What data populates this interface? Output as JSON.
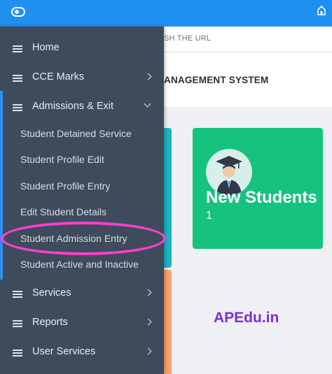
{
  "urlbar": {
    "text": "SH THE URL"
  },
  "header": {
    "title": "ANAGEMENT SYSTEM"
  },
  "sidebar": {
    "items": [
      {
        "label": "Home"
      },
      {
        "label": "CCE Marks"
      },
      {
        "label": "Admissions & Exit"
      }
    ],
    "submenu": [
      {
        "label": "Student Detained Service"
      },
      {
        "label": "Student Profile Edit"
      },
      {
        "label": "Student Profile Entry"
      },
      {
        "label": "Edit Student Details"
      },
      {
        "label": "Student Admission Entry"
      },
      {
        "label": "Student Active and Inactive"
      }
    ],
    "bottom_items": [
      {
        "label": "Services"
      },
      {
        "label": "Reports"
      },
      {
        "label": "User Services"
      }
    ]
  },
  "card": {
    "title": "New Students",
    "count": "1"
  },
  "watermark": "APEdu.in",
  "colors": {
    "topbar": "#1f8ff0",
    "sidebar": "#3e4b5c",
    "card": "#15c27e",
    "highlight": "#ff3fd0",
    "watermark": "#7b2fd6"
  }
}
